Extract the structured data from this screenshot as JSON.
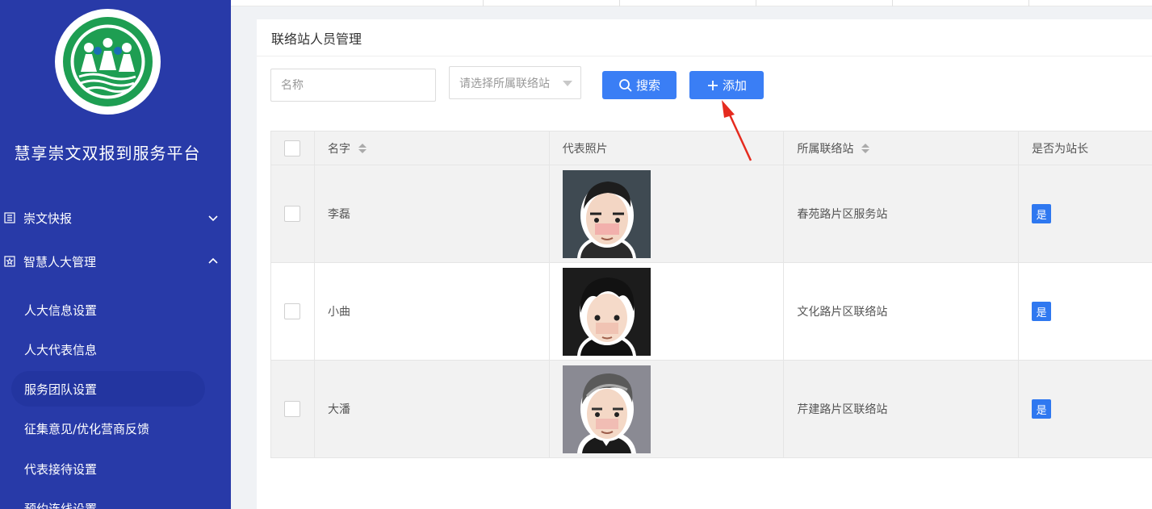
{
  "sidebar": {
    "app_title": "慧享崇文双报到服务平台",
    "groups": [
      {
        "label": "崇文快报",
        "icon": "document-icon",
        "expanded": false
      },
      {
        "label": "智慧人大管理",
        "icon": "star-badge-icon",
        "expanded": true
      }
    ],
    "sub_items": [
      {
        "label": "人大信息设置",
        "active": false
      },
      {
        "label": "人大代表信息",
        "active": false
      },
      {
        "label": "服务团队设置",
        "active": true
      },
      {
        "label": "征集意见/优化营商反馈",
        "active": false
      },
      {
        "label": "代表接待设置",
        "active": false
      },
      {
        "label": "预约连线设置",
        "active": false
      }
    ]
  },
  "panel": {
    "title": "联络站人员管理"
  },
  "filters": {
    "name_placeholder": "名称",
    "station_placeholder": "请选择所属联络站",
    "search_label": "搜索",
    "add_label": "添加"
  },
  "table": {
    "columns": [
      "名字",
      "代表照片",
      "所属联络站",
      "是否为站长"
    ],
    "rows": [
      {
        "name": "李磊",
        "avatar": "avatar-portrait-1",
        "station": "春苑路片区服务站",
        "is_head": "是"
      },
      {
        "name": "小曲",
        "avatar": "avatar-portrait-2",
        "station": "文化路片区联络站",
        "is_head": "是"
      },
      {
        "name": "大潘",
        "avatar": "avatar-portrait-3",
        "station": "芹建路片区联络站",
        "is_head": "是"
      }
    ]
  },
  "colors": {
    "sidebar_bg": "#283aa8",
    "primary": "#3a7ef5",
    "badge": "#2f78f0",
    "annotation": "#e52b1f"
  }
}
